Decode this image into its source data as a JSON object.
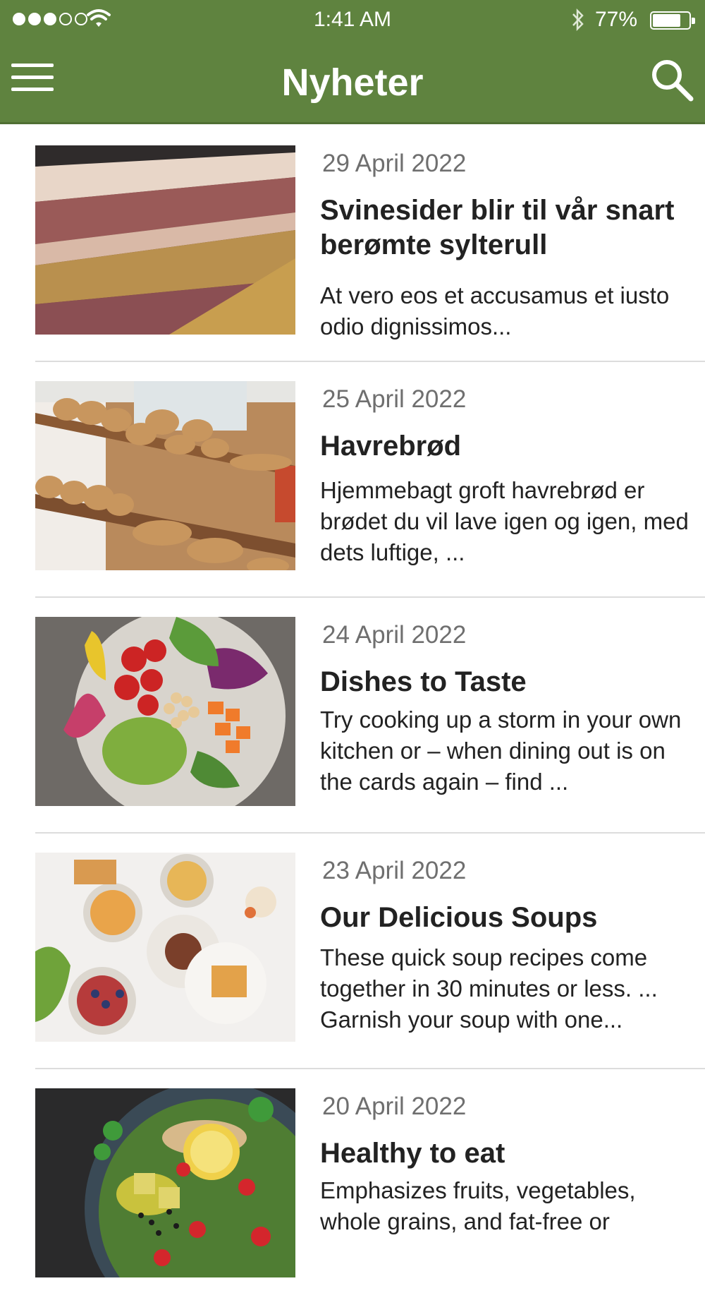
{
  "status_bar": {
    "time": "1:41 AM",
    "battery": "77%",
    "battery_level": 0.77
  },
  "header": {
    "title": "Nyheter",
    "menu_icon": "hamburger-menu-icon",
    "search_icon": "search-icon"
  },
  "articles": [
    {
      "date": "29 April 2022",
      "title": "Svinesider blir til vår snart berømte sylterull",
      "excerpt": "At vero eos et accusamus et iusto odio dignissimos...",
      "image": "pork-belly-photo"
    },
    {
      "date": "25 April 2022",
      "title": "Havrebrød",
      "excerpt": "Hjemmebagt groft havrebrød er brødet du vil lave igen og igen, med dets luftige, ...",
      "image": "bread-shelf-photo"
    },
    {
      "date": "24 April 2022",
      "title": "Dishes to Taste",
      "excerpt": "Try cooking up a storm in your own kitchen or – when dining out is on the cards again – find ...",
      "image": "salad-bowl-photo"
    },
    {
      "date": "23 April 2022",
      "title": "Our Delicious Soups",
      "excerpt": "These quick soup recipes come together in 30 minutes or less. ... Garnish your soup with one...",
      "image": "breakfast-table-photo"
    },
    {
      "date": "20 April 2022",
      "title": "Healthy to eat",
      "excerpt": "Emphasizes fruits, vegetables, whole grains, and fat-free or",
      "image": "healthy-salad-photo"
    }
  ]
}
